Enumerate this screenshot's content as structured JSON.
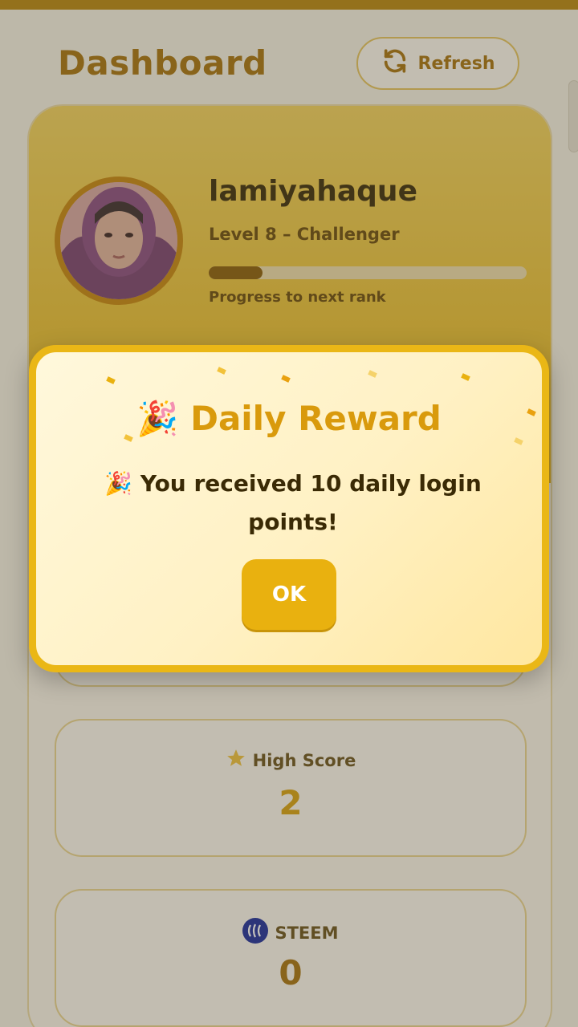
{
  "header": {
    "title": "Dashboard",
    "refresh_label": "Refresh"
  },
  "profile": {
    "username": "lamiyahaque",
    "level": "Level 8 – Challenger",
    "progress_label": "Progress to next rank",
    "progress_fraction": 0.17
  },
  "stats": [
    {
      "title": "High Score",
      "value": "2",
      "icon": "star-icon"
    },
    {
      "title": "STEEM",
      "value": "0",
      "icon": "steem-icon"
    }
  ],
  "modal": {
    "title_emoji": "🎉",
    "title": "Daily Reward",
    "message_emoji": "🎉",
    "message": "You received 10 daily login points!",
    "ok_label": "OK"
  },
  "colors": {
    "accent": "#e9b10f",
    "title": "#a8720a",
    "background": "#f7f3e3"
  }
}
